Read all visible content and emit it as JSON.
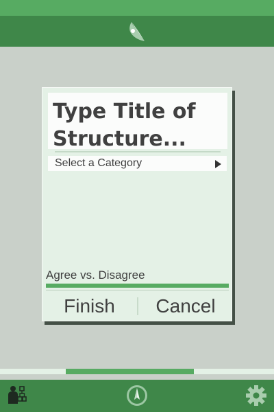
{
  "colors": {
    "accent": "#57ab62",
    "bar": "#3f8749",
    "background": "#c9d0c9",
    "dialog": "#e4f1e6",
    "text": "#404040"
  },
  "header": {
    "logo_icon": "leaf-logo-icon"
  },
  "dialog": {
    "title": "Type Title of\nStructure...",
    "category": "Select a Category",
    "category_icon": "triangle-right-icon",
    "agree_label": "Agree vs. Disagree",
    "agree_fraction": 1.0,
    "finish_label": "Finish",
    "cancel_label": "Cancel"
  },
  "tabs": {
    "active_index": 1,
    "count": 3
  },
  "bottom_nav": {
    "items": [
      {
        "icon": "structure-icon"
      },
      {
        "icon": "compass-icon"
      },
      {
        "icon": "gear-icon"
      }
    ]
  }
}
